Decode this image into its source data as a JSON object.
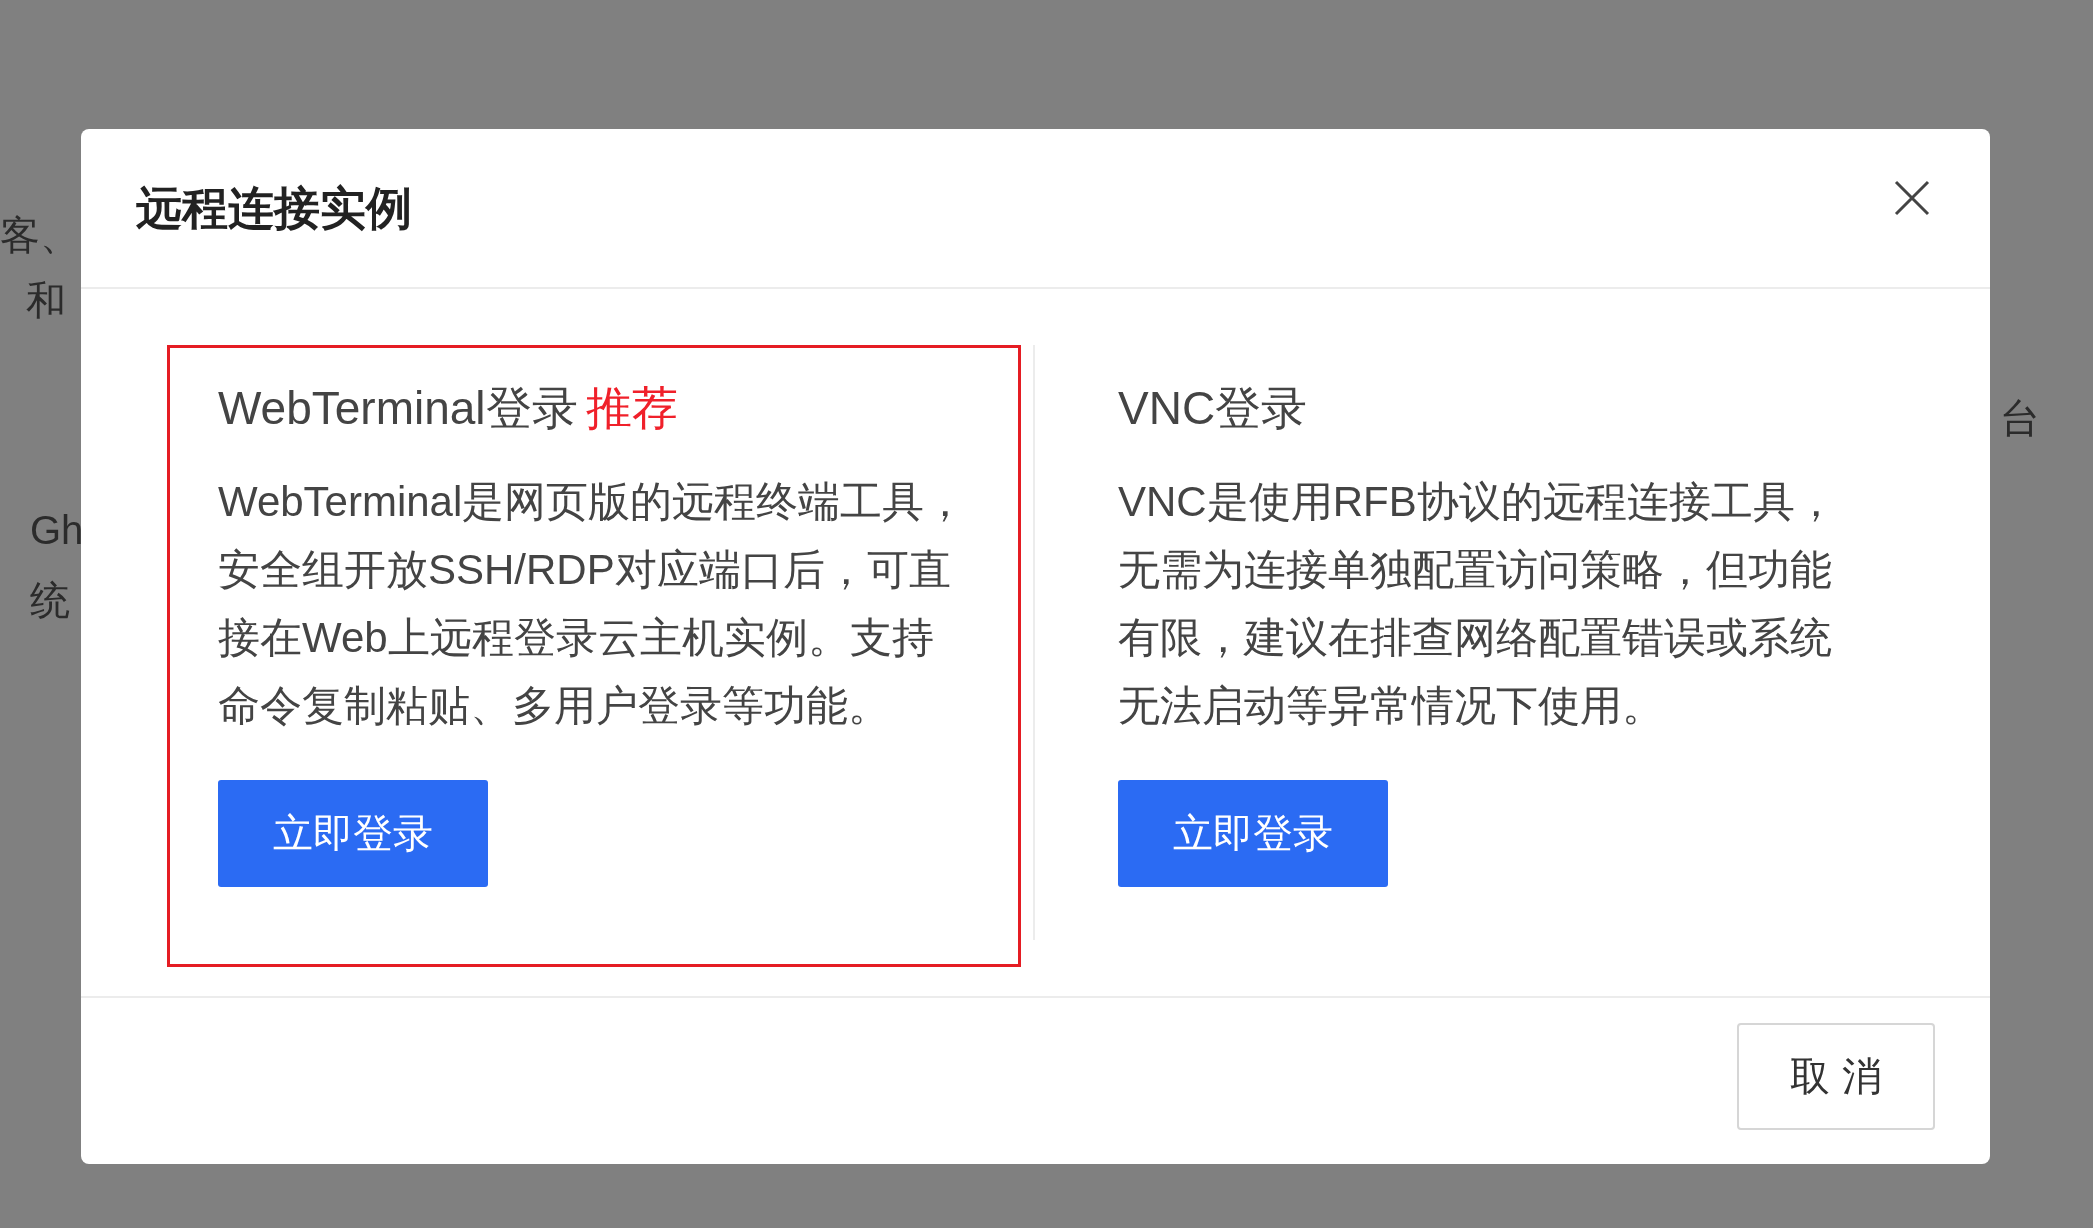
{
  "background": {
    "texts": [
      "客、",
      "和",
      "Gh",
      "统",
      "台"
    ]
  },
  "dialog": {
    "title": "远程连接实例",
    "options": [
      {
        "title": "WebTerminal登录",
        "badge": "推荐",
        "selected": true,
        "description": "WebTerminal是网页版的远程终端工具，安全组开放SSH/RDP对应端口后，可直接在Web上远程登录云主机实例。支持命令复制粘贴、多用户登录等功能。",
        "button": "立即登录"
      },
      {
        "title": "VNC登录",
        "selected": false,
        "description": "VNC是使用RFB协议的远程连接工具，无需为连接单独配置访问策略，但功能有限，建议在排查网络配置错误或系统无法启动等异常情况下使用。",
        "button": "立即登录"
      }
    ],
    "cancel": "取 消"
  }
}
